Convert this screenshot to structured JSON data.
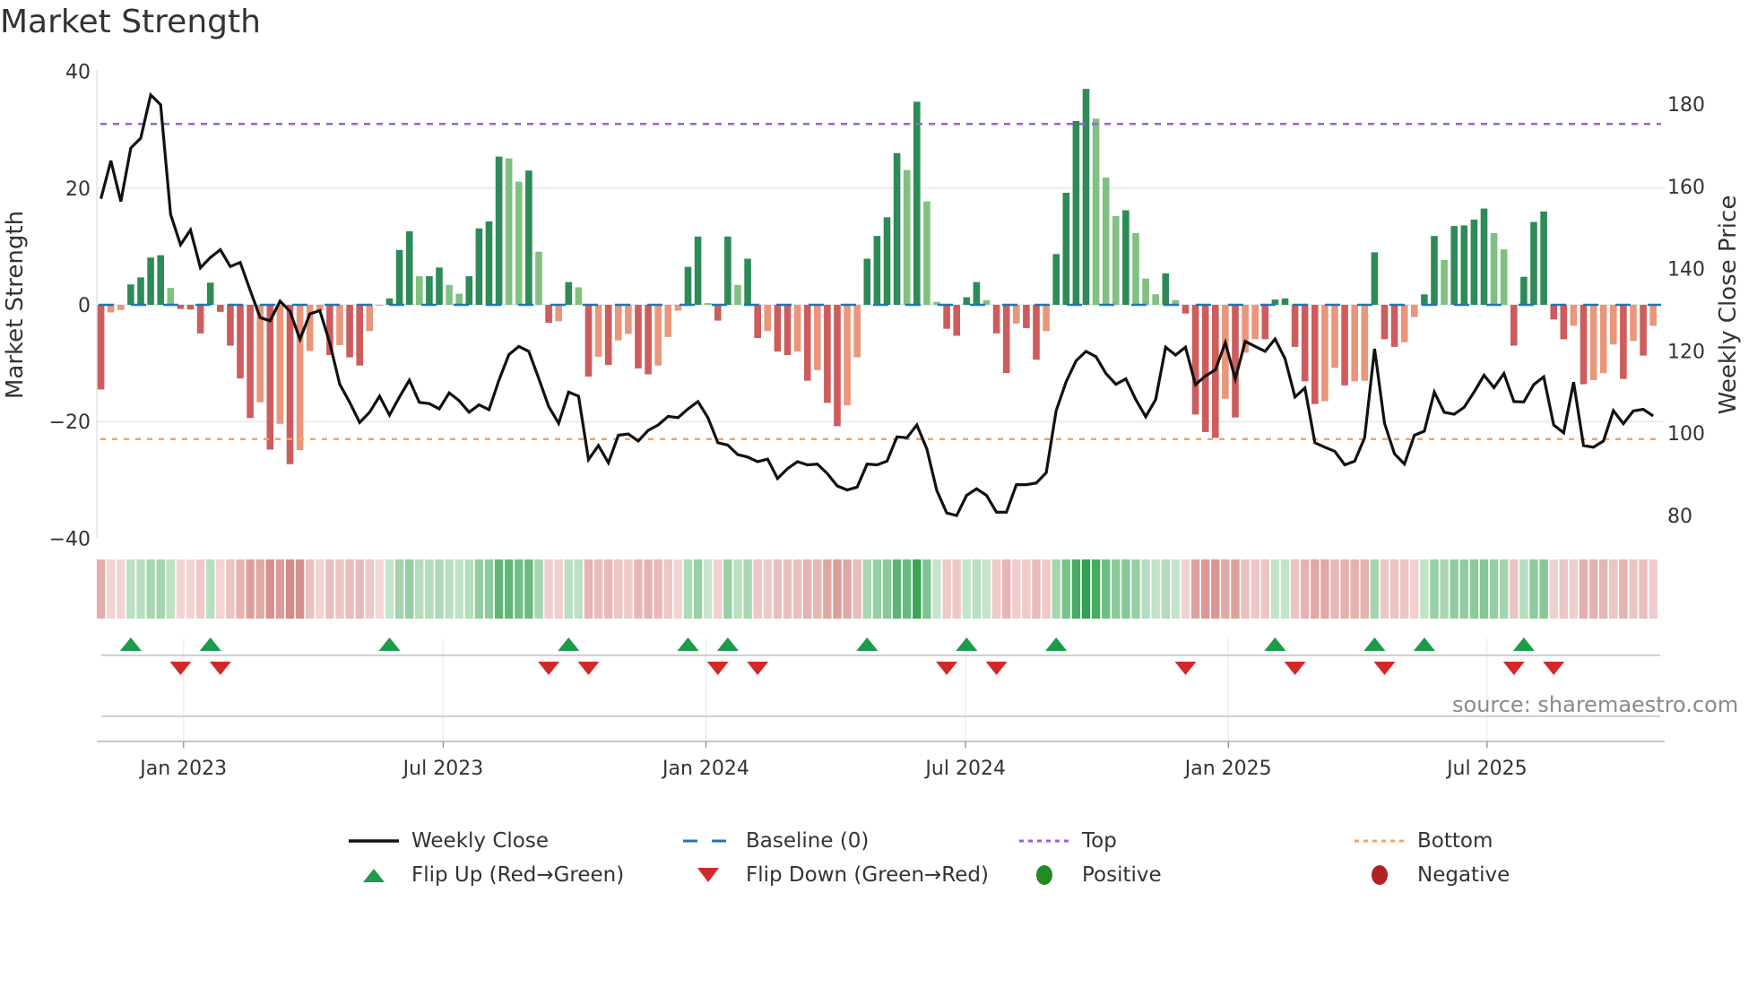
{
  "title": "Market Strength",
  "source": "source: sharemaestro.com",
  "colors": {
    "pos_strong": "#2e8b57",
    "pos_weak": "#80c080",
    "neg_strong": "#cd5c5c",
    "neg_weak": "#e9967a",
    "close_line": "#111111",
    "baseline": "#1f77b4",
    "top": "#9b5de5",
    "bottom": "#f4a460",
    "flip_up": "#1a9c4a",
    "flip_down": "#d62728",
    "positive": "#228b22",
    "negative": "#b22222"
  },
  "legend": [
    {
      "label": "Weekly Close",
      "key": "close"
    },
    {
      "label": "Baseline (0)",
      "key": "baseline"
    },
    {
      "label": "Top",
      "key": "top"
    },
    {
      "label": "Bottom",
      "key": "bottom"
    },
    {
      "label": "Flip Up (Red→Green)",
      "key": "flip_up"
    },
    {
      "label": "Flip Down (Green→Red)",
      "key": "flip_down"
    },
    {
      "label": "Positive",
      "key": "positive"
    },
    {
      "label": "Negative",
      "key": "negative"
    }
  ],
  "chart_data": {
    "type": "bar",
    "title": "Market Strength",
    "ylabel": "Market Strength",
    "y2label": "Weekly Close Price",
    "ylim": [
      -40,
      40
    ],
    "yticks": [
      "40",
      "20",
      "0",
      "−20",
      "−40"
    ],
    "ytick_values": [
      40,
      20,
      0,
      -20,
      -40
    ],
    "y2lim": [
      70,
      185
    ],
    "y2ticks": [
      "180",
      "160",
      "140",
      "120",
      "100",
      "80"
    ],
    "y2tick_values": [
      180,
      160,
      140,
      120,
      100,
      80
    ],
    "top_threshold": 31,
    "bottom_threshold": -23,
    "baseline": 0,
    "x_unit": "week index",
    "xticks": [
      {
        "label": "Jan 2023",
        "week": 8.3
      },
      {
        "label": "Jul 2023",
        "week": 34.4
      },
      {
        "label": "Jan 2024",
        "week": 60.8
      },
      {
        "label": "Jul 2024",
        "week": 86.9
      },
      {
        "label": "Jan 2025",
        "week": 113.3
      },
      {
        "label": "Jul 2025",
        "week": 139.3
      }
    ],
    "strength": [
      -14.5,
      -1.3,
      -0.9,
      3.5,
      4.7,
      8.1,
      8.5,
      2.9,
      -0.7,
      -0.8,
      -4.9,
      3.8,
      -1.2,
      -7,
      -12.6,
      -19.4,
      -16.7,
      -24.8,
      -20.4,
      -27.3,
      -24.9,
      -7.9,
      -1,
      -8.6,
      -6.9,
      -9,
      -10.4,
      -4.5,
      0,
      1.1,
      9.4,
      12.6,
      4.9,
      4.9,
      6.4,
      3.4,
      1.9,
      4.9,
      13.1,
      14.3,
      25.4,
      25.1,
      21.1,
      23,
      9.1,
      -3.1,
      -2.8,
      3.9,
      3,
      -12.3,
      -8.9,
      -10.3,
      -6.1,
      -5,
      -10.9,
      -11.9,
      -10.4,
      -5.5,
      -1,
      6.5,
      11.7,
      0.3,
      -2.7,
      11.7,
      3.4,
      7.9,
      -5.7,
      -4.5,
      -8,
      -8.6,
      -8,
      -13,
      -11.2,
      -16.8,
      -20.8,
      -17.2,
      -9,
      7.9,
      11.8,
      15,
      26,
      23.1,
      34.8,
      17.7,
      0.5,
      -4.1,
      -5.3,
      1.3,
      3.9,
      0.8,
      -4.9,
      -11.7,
      -3.2,
      -4,
      -9.4,
      -4.5,
      8.7,
      19.2,
      31.5,
      37,
      31.9,
      21.8,
      15.2,
      16.2,
      12.3,
      4.5,
      1.8,
      5.4,
      0.8,
      -1.5,
      -18.8,
      -21.8,
      -22.8,
      -16.1,
      -19.3,
      -8.2,
      -5.9,
      -5.9,
      0.9,
      1.1,
      -7.2,
      -13.1,
      -17,
      -16.5,
      -10.8,
      -13.8,
      -13.1,
      -13,
      9,
      -5.9,
      -7.2,
      -6.4,
      -2.1,
      1.8,
      11.8,
      7.7,
      13.5,
      13.6,
      14.6,
      16.5,
      12.3,
      9.5,
      -7,
      4.8,
      14.2,
      16,
      -2.5,
      -5.9,
      -3.6,
      -13.6,
      -12.9,
      -11.7,
      -6.8,
      -12.7,
      -6.2,
      -8.7,
      -3.6
    ],
    "weekly_close": [
      157,
      166.2,
      156.3,
      169.3,
      171.7,
      182.2,
      179.8,
      153.2,
      145.8,
      149.4,
      140.2,
      142.7,
      144.6,
      140.5,
      141.5,
      134.7,
      128.1,
      127.3,
      132.1,
      129.6,
      122.8,
      129,
      129.8,
      121.9,
      111.9,
      107.5,
      102.6,
      105.1,
      109,
      104.4,
      108.8,
      112.9,
      107.5,
      107.2,
      105.9,
      109.8,
      107.9,
      105.1,
      106.9,
      105.7,
      112.9,
      119.1,
      121.1,
      119.9,
      113.3,
      106.5,
      102.4,
      110,
      109,
      93.6,
      97,
      92.8,
      99.5,
      99.8,
      98.1,
      100.7,
      102,
      104.1,
      103.8,
      105.9,
      107.7,
      103.8,
      97.7,
      97.1,
      94.8,
      94.2,
      93.1,
      93.7,
      89,
      91.4,
      93.1,
      92.3,
      92.5,
      90.2,
      87.2,
      86.2,
      86.9,
      92.5,
      92.3,
      93.2,
      99.1,
      98.9,
      102,
      96.2,
      86.1,
      80.6,
      80,
      84.9,
      86.5,
      84.9,
      80.8,
      80.8,
      87.5,
      87.5,
      87.9,
      90.4,
      105.5,
      112.5,
      117.6,
      119.9,
      118.6,
      114.5,
      111.9,
      113.2,
      108.2,
      104,
      108.2,
      120.9,
      119,
      120.9,
      111.8,
      113.9,
      115.4,
      122,
      113.2,
      122.3,
      121.1,
      119.9,
      122.9,
      118.1,
      108.8,
      111,
      97.7,
      96.6,
      95.6,
      92.3,
      93.2,
      98.9,
      120.5,
      102.4,
      95,
      92.5,
      99.5,
      100.5,
      110,
      105.1,
      104.6,
      106.3,
      110,
      114.1,
      111.1,
      114.5,
      107.7,
      107.6,
      111.8,
      113.7,
      102,
      100.1,
      112.4,
      97,
      96.6,
      98.1,
      105.5,
      102.3,
      105.4,
      105.8,
      104.2
    ],
    "flip_up_weeks": [
      3,
      11,
      29,
      47,
      59,
      63,
      77,
      87,
      96,
      118,
      128,
      133,
      143
    ],
    "flip_down_weeks": [
      8,
      12,
      45,
      49,
      62,
      66,
      85,
      90,
      109,
      120,
      129,
      142,
      146
    ],
    "strength_max_abs": 37
  }
}
